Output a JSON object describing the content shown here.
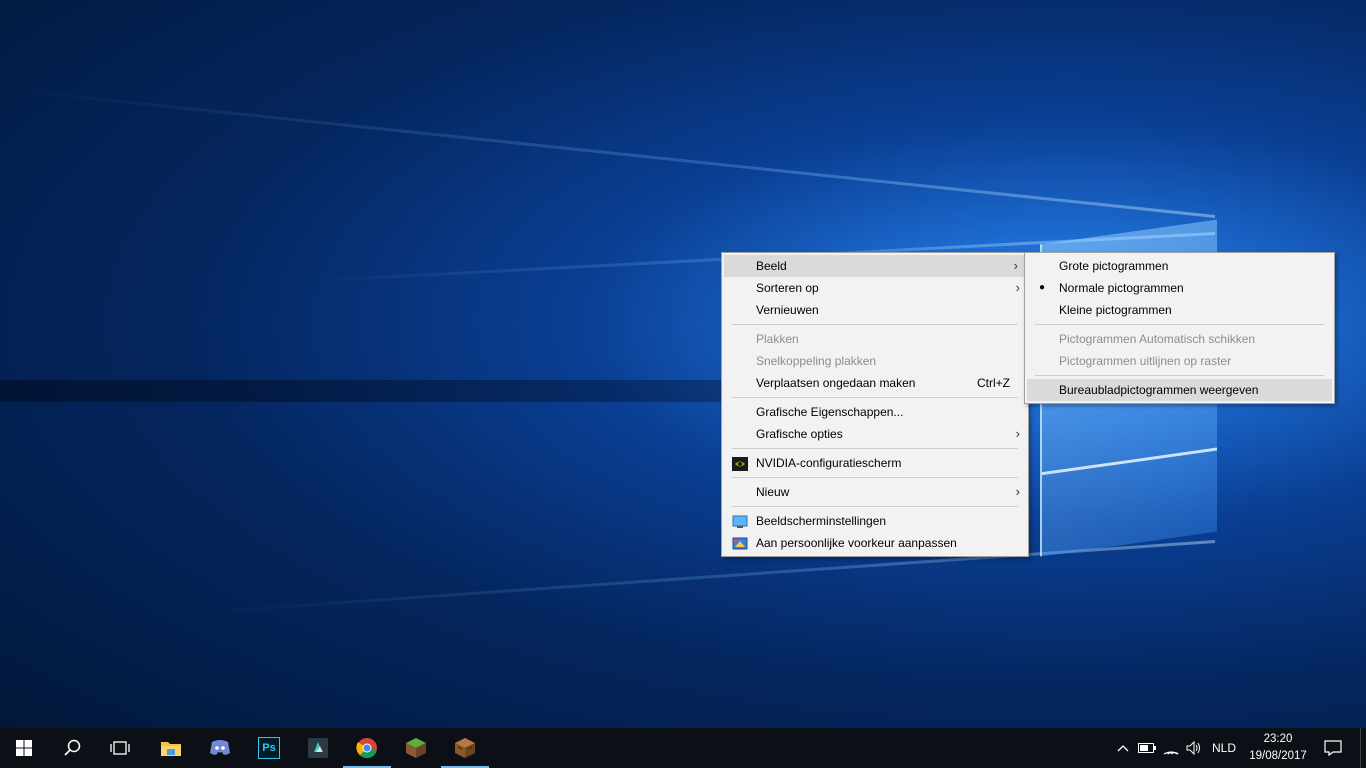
{
  "desktop": {
    "wallpaper": "windows-10-hero",
    "accent": "#1e6fd6"
  },
  "context_menu": {
    "items": [
      {
        "label": "Beeld",
        "submenu": true,
        "highlighted": true
      },
      {
        "label": "Sorteren op",
        "submenu": true
      },
      {
        "label": "Vernieuwen"
      },
      {
        "label": "Plakken",
        "disabled": true
      },
      {
        "label": "Snelkoppeling plakken",
        "disabled": true
      },
      {
        "label": "Verplaatsen ongedaan maken",
        "shortcut": "Ctrl+Z"
      },
      {
        "label": "Grafische Eigenschappen..."
      },
      {
        "label": "Grafische opties",
        "submenu": true
      },
      {
        "label": "NVIDIA-configuratiescherm",
        "icon": "nvidia-icon"
      },
      {
        "label": "Nieuw",
        "submenu": true
      },
      {
        "label": "Beeldscherminstellingen",
        "icon": "display-icon"
      },
      {
        "label": "Aan persoonlijke voorkeur aanpassen",
        "icon": "personalize-icon"
      }
    ]
  },
  "submenu": {
    "items": [
      {
        "label": "Grote pictogrammen"
      },
      {
        "label": "Normale pictogrammen",
        "checked": true
      },
      {
        "label": "Kleine pictogrammen"
      },
      {
        "label": "Pictogrammen Automatisch schikken",
        "disabled": true
      },
      {
        "label": "Pictogrammen uitlijnen op raster",
        "disabled": true
      },
      {
        "label": "Bureaubladpictogrammen weergeven",
        "highlighted": true
      }
    ]
  },
  "taskbar": {
    "apps": [
      "start-icon",
      "search-icon",
      "task-view-icon",
      "file-explorer-icon",
      "discord-icon",
      "photoshop-icon",
      "filmora-icon",
      "chrome-icon",
      "minecraft-icon",
      "crafting-table-icon"
    ],
    "photoshop_label": "Ps",
    "tray": {
      "language": "NLD",
      "time": "23:20",
      "date": "19/08/2017"
    }
  }
}
